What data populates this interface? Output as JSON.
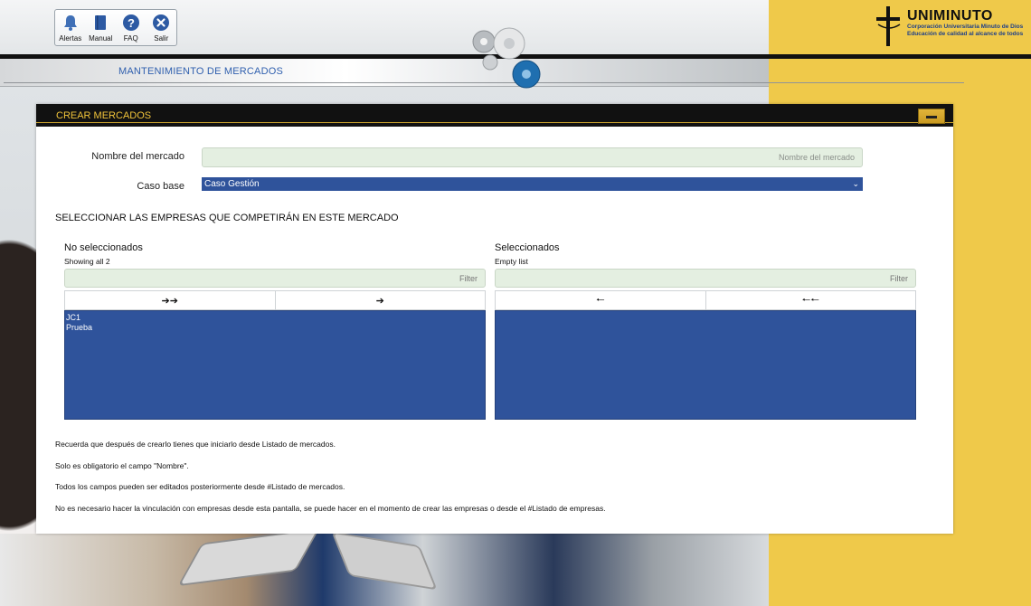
{
  "toolbar": {
    "alerts_label": "Alertas",
    "manual_label": "Manual",
    "faq_label": "FAQ",
    "exit_label": "Salir"
  },
  "header": {
    "section_title": "MANTENIMIENTO DE MERCADOS"
  },
  "logo": {
    "name": "UNIMINUTO",
    "line1": "Corporación Universitaria Minuto de Dios",
    "line2": "Educación de calidad al alcance de todos"
  },
  "panel": {
    "title": "CREAR MERCADOS"
  },
  "form": {
    "name_label": "Nombre del mercado",
    "name_value": "",
    "name_placeholder": "Nombre del mercado",
    "case_label": "Caso base",
    "case_value": "Caso Gestión"
  },
  "companies": {
    "section_title": "SELECCIONAR LAS EMPRESAS QUE COMPETIRÁN EN ESTE MERCADO",
    "left": {
      "title": "No seleccionados",
      "info": "Showing all 2",
      "filter_placeholder": "Filter",
      "move_all_label": "➔➔",
      "move_label": "➔",
      "items": [
        "JC1",
        "Prueba"
      ]
    },
    "right": {
      "title": "Seleccionados",
      "info": "Empty list",
      "filter_placeholder": "Filter",
      "remove_label": "🠐",
      "remove_all_label": "🠐🠐",
      "items": []
    }
  },
  "notes": [
    "Recuerda que después de crearlo tienes que iniciarlo desde Listado de mercados.",
    "Solo es obligatorio el campo \"Nombre\".",
    "Todos los campos pueden ser editados posteriormente desde #Listado de mercados.",
    "No es necesario hacer la vinculación con empresas desde esta pantalla, se puede hacer en el momento de crear las empresas o desde el #Listado de empresas."
  ],
  "colors": {
    "accent_blue": "#2f539b",
    "title_blue": "#2f5fae",
    "brand_yellow": "#efc94a",
    "panel_title_yellow": "#f0c33a"
  },
  "icons": {
    "alerts": "bell-icon",
    "manual": "book-icon",
    "faq": "question-icon",
    "exit": "close-circle-icon"
  }
}
